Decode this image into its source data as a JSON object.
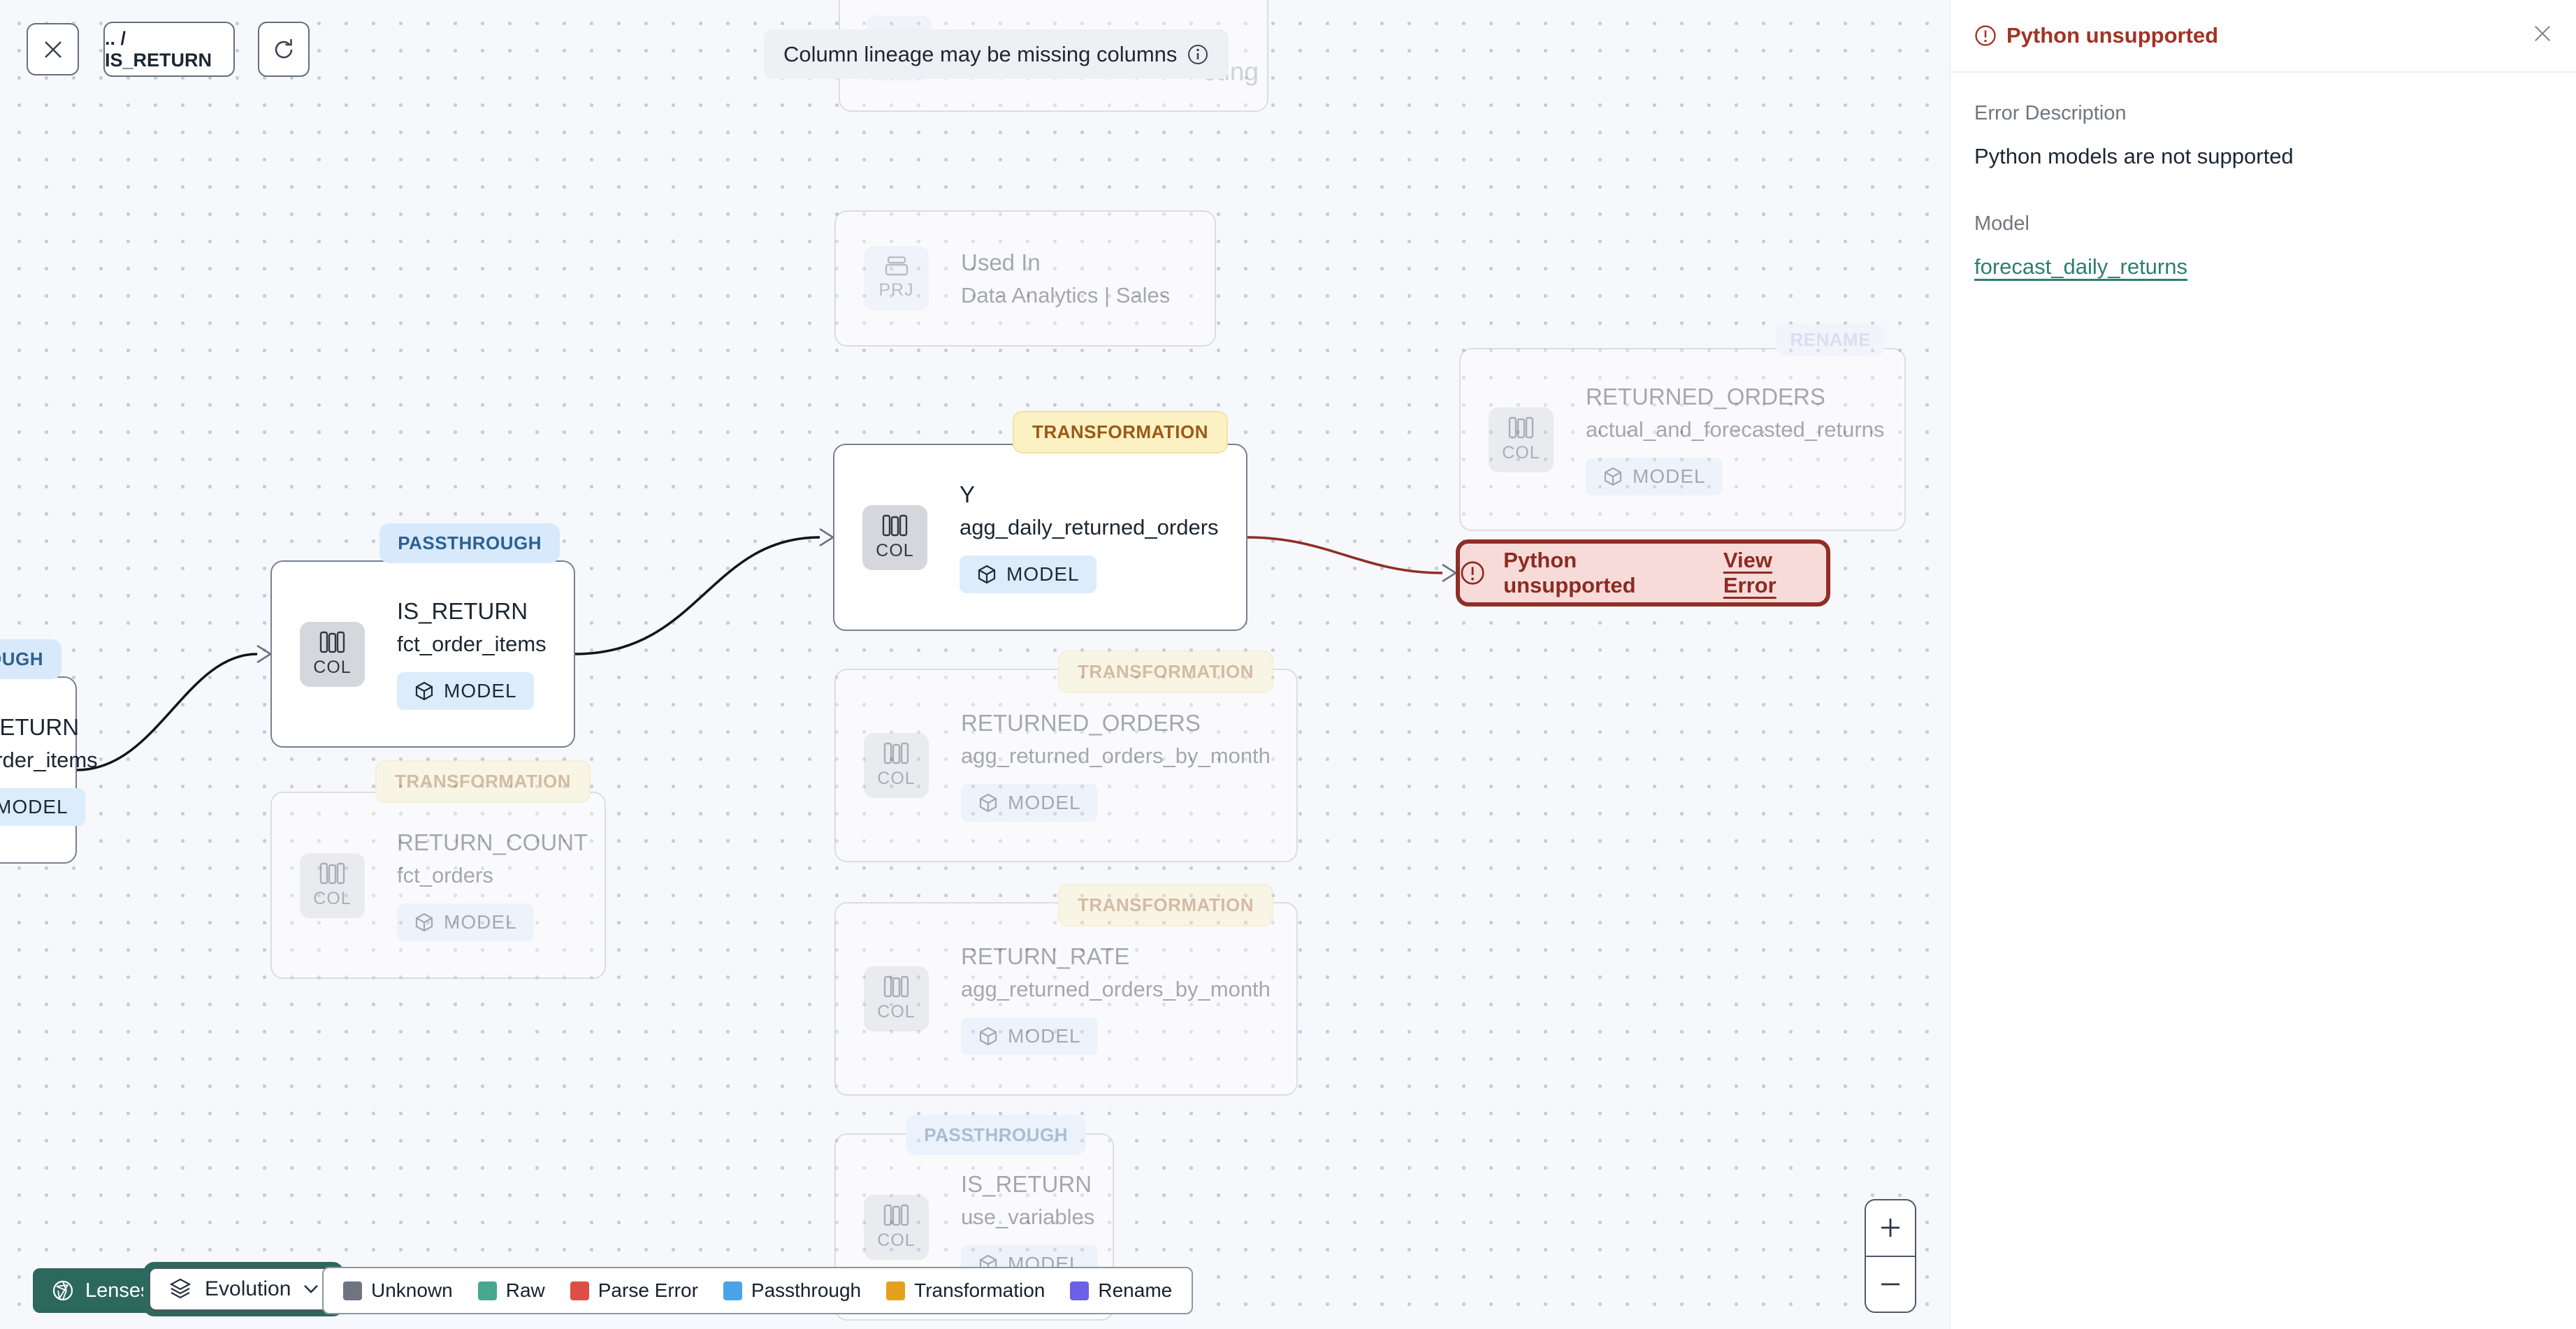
{
  "top_controls": {
    "breadcrumb": ".. / IS_RETURN"
  },
  "banner": {
    "text": "Column lineage may be missing columns"
  },
  "tags": {
    "passthrough": "PASSTHROUGH",
    "transformation": "TRANSFORMATION",
    "rename": "RENAME"
  },
  "badges": {
    "col": "COL",
    "model": "MODEL",
    "prj": "PRJ"
  },
  "nodes": {
    "cut_left": {
      "title": "IS_RETURN",
      "subtitle": "fct_order_items"
    },
    "cut_top": {
      "subtitle_fragment": "eting"
    },
    "used_in": {
      "title": "Used In",
      "subtitle": "Data Analytics | Sales"
    },
    "is_return": {
      "title": "IS_RETURN",
      "subtitle": "fct_order_items"
    },
    "y_agg": {
      "title": "Y",
      "subtitle": "agg_daily_returned_orders"
    },
    "returned_orders_rename": {
      "title": "RETURNED_ORDERS",
      "subtitle": "actual_and_forecasted_returns"
    },
    "returned_orders_month": {
      "title": "RETURNED_ORDERS",
      "subtitle": "agg_returned_orders_by_month"
    },
    "return_rate": {
      "title": "RETURN_RATE",
      "subtitle": "agg_returned_orders_by_month"
    },
    "return_count": {
      "title": "RETURN_COUNT",
      "subtitle": "fct_orders"
    },
    "use_variables": {
      "title": "IS_RETURN",
      "subtitle": "use_variables"
    }
  },
  "error_node": {
    "label": "Python unsupported",
    "action": "View Error"
  },
  "sidebar": {
    "title": "Python unsupported",
    "error_description_label": "Error Description",
    "error_description": "Python models are not supported",
    "model_label": "Model",
    "model_link": "forecast_daily_returns"
  },
  "bottom_bar": {
    "lenses": "Lenses",
    "evolution": "Evolution"
  },
  "legend": {
    "items": [
      {
        "label": "Unknown",
        "color": "#6e7480"
      },
      {
        "label": "Raw",
        "color": "#47a88f"
      },
      {
        "label": "Parse Error",
        "color": "#dc4f47"
      },
      {
        "label": "Passthrough",
        "color": "#4aa3e8"
      },
      {
        "label": "Transformation",
        "color": "#e3a11e"
      },
      {
        "label": "Rename",
        "color": "#6c5fe8"
      }
    ]
  },
  "zoom_controls": {
    "zoom_in": "+",
    "zoom_out": "−"
  },
  "colors": {
    "error_red": "#8f2e26",
    "link_teal": "#2f7d6e",
    "lenses_teal": "#2d685d"
  }
}
